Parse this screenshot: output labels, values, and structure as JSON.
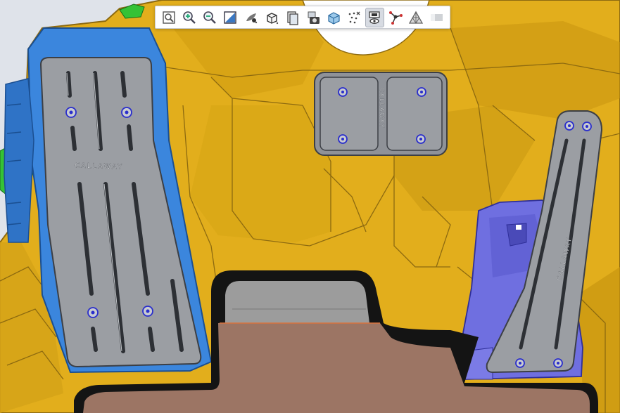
{
  "app": {
    "toolbar": {
      "tools": [
        {
          "id": "zoom-area",
          "icon": "zoom-area-icon"
        },
        {
          "id": "zoom-in",
          "icon": "zoom-in-icon"
        },
        {
          "id": "zoom-out",
          "icon": "zoom-out-icon"
        },
        {
          "id": "fit-all",
          "icon": "fit-all-icon"
        },
        {
          "id": "render-style",
          "icon": "render-style-icon"
        },
        {
          "id": "view-orientation",
          "icon": "view-cube-icon"
        },
        {
          "id": "view-layout",
          "icon": "view-layout-icon"
        },
        {
          "id": "capture-image",
          "icon": "camera-icon"
        },
        {
          "id": "section-view",
          "icon": "section-box-icon"
        },
        {
          "id": "show-hide-points",
          "icon": "points-icon"
        },
        {
          "id": "visibility-mode",
          "icon": "visibility-toggle-icon",
          "active": true
        },
        {
          "id": "show-hide-curves",
          "icon": "curves-icon"
        },
        {
          "id": "show-hide-mesh",
          "icon": "mesh-icon"
        },
        {
          "id": "lighting",
          "icon": "lighting-icon"
        }
      ]
    }
  },
  "scene": {
    "colors": {
      "background": "#dfe3ea",
      "footwell": "#e2ae1c",
      "footwell_edge": "#8d6a10",
      "brake_bracket": "#3b86dd",
      "pedal_plate": "#9b9ea3",
      "accelerator_bracket": "#6f6fe0",
      "floor_mat": "#9c7564",
      "floor_rim": "#141414",
      "green_clip": "#35c235"
    },
    "brake_pedal": {
      "logo": "CALLAWAY"
    },
    "dead_pedal": {
      "logo": "CALLAWAY"
    },
    "accelerator_pedal": {
      "logo": "CALLAWAY"
    }
  }
}
